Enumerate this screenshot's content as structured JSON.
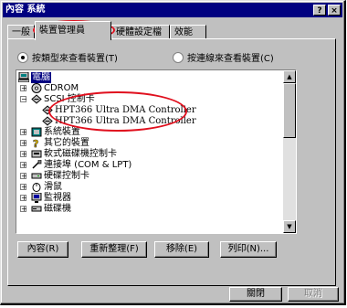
{
  "window": {
    "title": "內容 系統",
    "help_btn": "?",
    "close_btn": "×"
  },
  "tabs": [
    "一般",
    "裝置管理員",
    "硬體設定檔",
    "效能"
  ],
  "view": {
    "by_type": "按類型來查看裝置(T)",
    "by_connection": "按連線來查看裝置(C)"
  },
  "tree": [
    {
      "label": "電腦",
      "icon": "computer-icon",
      "selected": true
    },
    {
      "label": "CDROM",
      "icon": "cdrom-icon",
      "expander": "+"
    },
    {
      "label": "SCSI 控制卡",
      "icon": "scsi-icon",
      "expander": "−"
    },
    {
      "label": "HPT366 Ultra DMA Controller",
      "icon": "scsi-icon"
    },
    {
      "label": "HPT366 Ultra DMA Controller",
      "icon": "scsi-icon"
    },
    {
      "label": "系統裝置",
      "icon": "system-device-icon",
      "expander": "+"
    },
    {
      "label": "其它的裝置",
      "icon": "question-icon",
      "expander": "+"
    },
    {
      "label": "軟式磁碟機控制卡",
      "icon": "floppy-controller-icon",
      "expander": "+"
    },
    {
      "label": "連接埠 (COM & LPT)",
      "icon": "port-icon",
      "expander": "+"
    },
    {
      "label": "硬碟控制卡",
      "icon": "disk-controller-icon",
      "expander": "+"
    },
    {
      "label": "滑鼠",
      "icon": "mouse-icon",
      "expander": "+"
    },
    {
      "label": "監視器",
      "icon": "monitor-icon",
      "expander": "+"
    },
    {
      "label": "磁碟機",
      "icon": "disk-drive-icon",
      "expander": "+"
    }
  ],
  "buttons": {
    "properties": "內容(R)",
    "refresh": "重新整理(F)",
    "remove": "移除(E)",
    "print": "列印(N)...",
    "close": "關閉",
    "cancel": "取消"
  },
  "colors": {
    "title_bar": "#000080",
    "highlight": "#e0101e",
    "face": "#c0c0c0"
  }
}
